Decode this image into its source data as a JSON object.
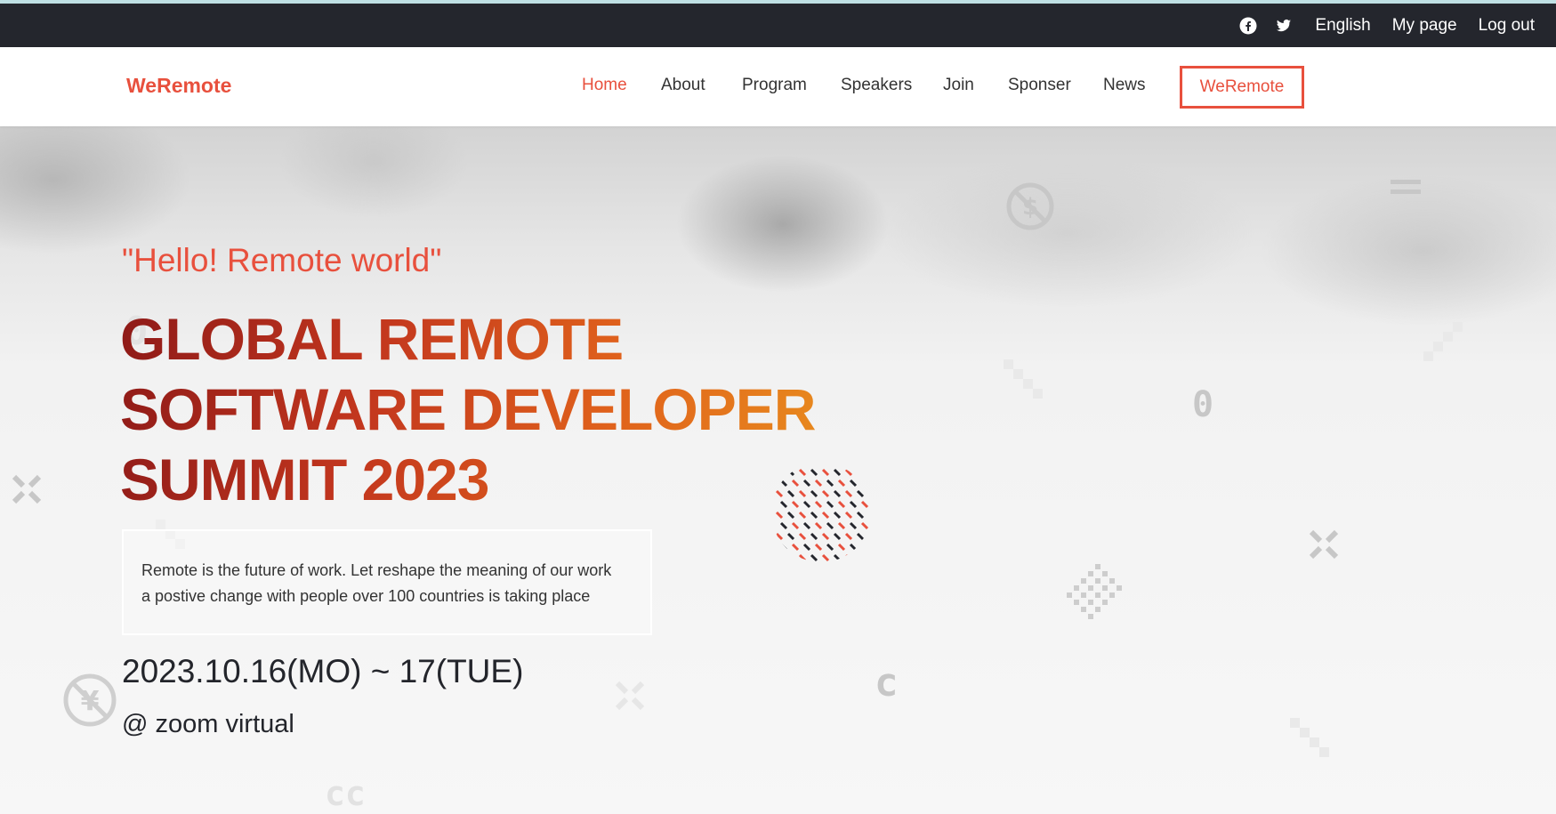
{
  "topbar": {
    "icons": [
      "facebook-icon",
      "twitter-icon"
    ],
    "links": [
      "English",
      "My page",
      "Log out"
    ]
  },
  "navbar": {
    "brand": "WeRemote",
    "items": [
      "Home",
      "About",
      "Program",
      "Speakers",
      "Join",
      "Sponser",
      "News"
    ],
    "active": "Home",
    "cta": "WeRemote"
  },
  "hero": {
    "tagline": "\"Hello! Remote world\"",
    "title_lines": [
      "GLOBAL REMOTE",
      "SOFTWARE DEVELOPER",
      "SUMMIT 2023"
    ],
    "description_lines": [
      "Remote is the future of work. Let reshape the meaning of our work",
      "a postive change with people over 100 countries is taking place"
    ],
    "date": "2023.10.16(MO) ~ 17(TUE)",
    "venue": "@ zoom virtual"
  },
  "decorations": [
    "no-dollar-icon",
    "no-yen-icon",
    "close-x-icon",
    "equals-icon",
    "zero-glyph",
    "c-glyph",
    "dot-circle-pattern",
    "diamond-grid-pattern"
  ],
  "colors": {
    "accent": "#e8503d",
    "topbar_bg": "#24262d",
    "title_gradient_start": "#8e1a18",
    "title_gradient_end": "#e88a1e",
    "text_dark": "#23252b"
  }
}
